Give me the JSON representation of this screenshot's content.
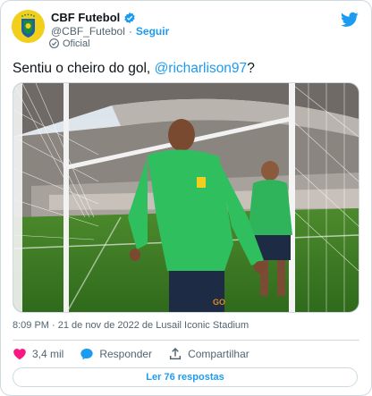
{
  "account": {
    "display_name": "CBF Futebol",
    "handle": "@CBF_Futebol",
    "separator": "·",
    "follow_label": "Seguir",
    "label": "Oficial"
  },
  "tweet": {
    "text_before": "Sentiu o cheiro do gol, ",
    "mention": "@richarlison97",
    "text_after": "?",
    "meta": "8:09 PM · 21 de nov de 2022 de Lusail Iconic Stadium"
  },
  "actions": {
    "likes": "3,4 mil",
    "reply_label": "Responder",
    "share_label": "Compartilhar"
  },
  "replies_button": "Ler 76 respostas",
  "colors": {
    "accent": "#1d9bf0",
    "like": "#f91880",
    "muted": "#536471",
    "border": "#cfd9de"
  },
  "icons": [
    "cbf-logo-icon",
    "verified-badge-icon",
    "twitter-logo-icon",
    "official-label-icon",
    "heart-icon",
    "reply-icon",
    "share-icon"
  ]
}
